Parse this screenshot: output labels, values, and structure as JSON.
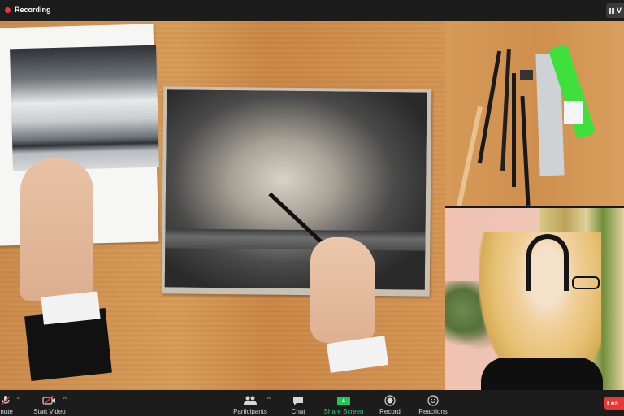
{
  "topbar": {
    "recording_label": "Recording",
    "view_label": "V"
  },
  "toolbar": {
    "mute_label": "mute",
    "start_video_label": "Start Video",
    "participants_label": "Participants",
    "chat_label": "Chat",
    "share_screen_label": "Share Screen",
    "record_label": "Record",
    "reactions_label": "Reactions",
    "leave_label": "Lea",
    "caret": "^"
  },
  "colors": {
    "recording_red": "#e53935",
    "share_green": "#23c45b",
    "leave_red": "#e53935"
  },
  "icons": {
    "recording": "recording-dot-icon",
    "view": "grid-view-icon",
    "mute": "microphone-muted-icon",
    "video": "camera-off-icon",
    "participants": "participants-icon",
    "chat": "chat-bubble-icon",
    "share": "share-screen-icon",
    "record": "record-icon",
    "reactions": "reaction-smiley-icon"
  }
}
